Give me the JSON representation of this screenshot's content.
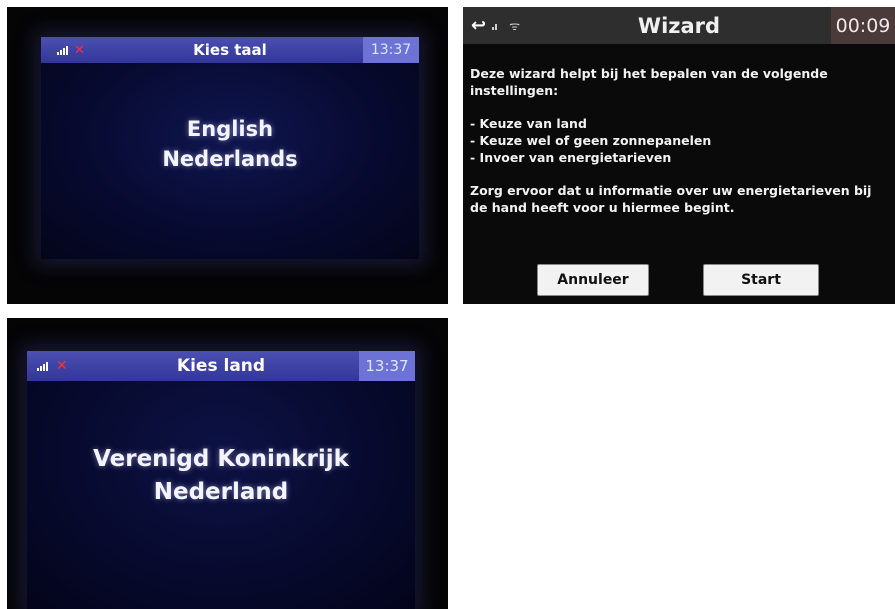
{
  "screen_language": {
    "title": "Kies taal",
    "time": "13:37",
    "options": [
      "English",
      "Nederlands"
    ]
  },
  "screen_wizard": {
    "title": "Wizard",
    "time": "00:09",
    "intro": "Deze wizard helpt bij het bepalen van de volgende instellingen:",
    "items": [
      "- Keuze van land",
      "- Keuze wel of geen zonnepanelen",
      "- Invoer van energietarieven"
    ],
    "note": "Zorg ervoor dat u informatie over uw energietarieven bij de hand heeft voor u hiermee begint.",
    "cancel_label": "Annuleer",
    "start_label": "Start"
  },
  "screen_country": {
    "title": "Kies land",
    "time": "13:37",
    "options": [
      "Verenigd Koninkrijk",
      "Nederland"
    ]
  },
  "colors": {
    "header_blue": "#3b3f9a",
    "clock_box": "#6d73d6",
    "screen_bg": "#06082a",
    "wizard_header": "#2f2f2f",
    "wizard_clock": "#4a3a3a",
    "error_red": "#ff3030"
  },
  "icons": [
    "signal-icon",
    "error-x-icon",
    "back-arrow-icon",
    "wifi-icon"
  ]
}
